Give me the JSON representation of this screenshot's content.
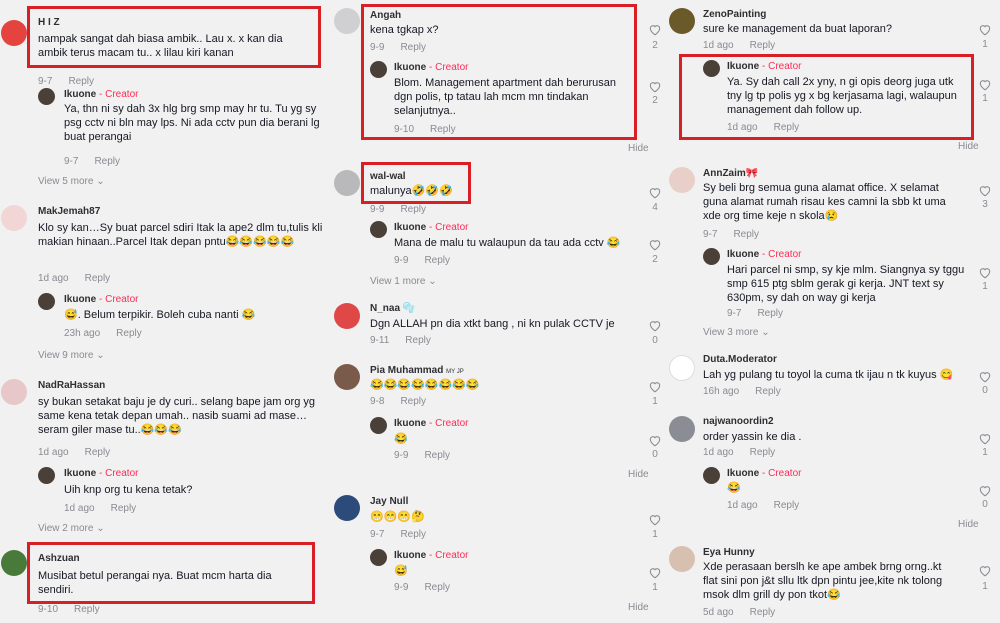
{
  "columns": [
    {
      "comments": [
        {
          "username": "H I Z",
          "text": "nampak sangat dah biasa ambik.. Lau x. x kan dia ambik terus macam tu.. x lilau kiri kanan",
          "date": "9-7",
          "reply": "Reply",
          "likes": "",
          "avatar": "#e4433e",
          "replies": [
            {
              "username": "Ikuone",
              "creator": "- Creator",
              "text": "Ya, thn ni sy dah 3x hlg brg smp may hr tu. Tu yg sy psg cctv ni bln may lps. Ni ada cctv pun dia berani lg buat perangai",
              "date": "9-7",
              "reply": "Reply",
              "likes": ""
            }
          ],
          "more": "View 5 more"
        },
        {
          "username": "MakJemah87",
          "text": "Klo sy kan…Sy buat parcel sdiri Itak la ape2 dlm tu,tulis kli makian hinaan..Parcel Itak depan pntu😂😂😂😂😂",
          "date": "1d ago",
          "reply": "Reply",
          "likes": "",
          "avatar": "#f2d6d6",
          "replies": [
            {
              "username": "Ikuone",
              "creator": "- Creator",
              "text": "😅. Belum terpikir. Boleh cuba nanti 😂",
              "date": "23h ago",
              "reply": "Reply",
              "likes": ""
            }
          ],
          "more": "View 9 more"
        },
        {
          "username": "NadRaHassan",
          "text": "sy bukan setakat baju je dy curi.. selang bape jam org yg same kena tetak depan umah.. nasib suami ad mase… seram giler mase tu..😂😂😂",
          "date": "1d ago",
          "reply": "Reply",
          "likes": "",
          "avatar": "#e7c7c9",
          "replies": [
            {
              "username": "Ikuone",
              "creator": "- Creator",
              "text": "Uih knp org tu kena tetak?",
              "date": "1d ago",
              "reply": "Reply",
              "likes": ""
            }
          ],
          "more": "View 2 more"
        },
        {
          "username": "Ashzuan",
          "text": "Musibat betul perangai nya. Buat mcm harta dia sendiri.",
          "date": "9-10",
          "reply": "Reply",
          "likes": "",
          "avatar": "#4a7a3a",
          "replies": []
        }
      ]
    },
    {
      "comments": [
        {
          "username": "Angah",
          "text": "kena tgkap x?",
          "date": "9-9",
          "reply": "Reply",
          "likes": "2",
          "avatar": "#d0d0d2",
          "replies": [
            {
              "username": "Ikuone",
              "creator": "- Creator",
              "text": "Blom. Management apartment dah berurusan dgn polis, tp tatau lah mcm mn tindakan selanjutnya..",
              "date": "9-10",
              "reply": "Reply",
              "likes": "2"
            }
          ],
          "hide": "Hide"
        },
        {
          "username": "wal-wal",
          "text": "malunya🤣🤣🤣",
          "date": "9-9",
          "reply": "Reply",
          "likes": "4",
          "avatar": "#b9b9bb",
          "replies": [
            {
              "username": "Ikuone",
              "creator": "- Creator",
              "text": "Mana de malu tu walaupun da tau ada cctv 😂",
              "date": "9-9",
              "reply": "Reply",
              "likes": "2"
            }
          ],
          "more": "View 1 more"
        },
        {
          "username": "N_naa 🫧",
          "text": "Dgn ALLAH pn dia xtkt bang , ni kn pulak CCTV je",
          "date": "9-11",
          "reply": "Reply",
          "likes": "0",
          "avatar": "#e04848",
          "replies": []
        },
        {
          "username": "Pia Muhammad",
          "badge": "MY JP",
          "text": "😂😂😂😂😂😂😂😂",
          "date": "9-8",
          "reply": "Reply",
          "likes": "1",
          "avatar": "#7a5a4a",
          "replies": [
            {
              "username": "Ikuone",
              "creator": "- Creator",
              "text": "😂",
              "date": "9-9",
              "reply": "Reply",
              "likes": "0"
            }
          ],
          "hide": "Hide"
        },
        {
          "username": "Jay Null",
          "text": "😁😁😁🤔",
          "date": "9-7",
          "reply": "Reply",
          "likes": "1",
          "avatar": "#2c4a7a",
          "replies": [
            {
              "username": "Ikuone",
              "creator": "- Creator",
              "text": "😅",
              "date": "9-9",
              "reply": "Reply",
              "likes": "1"
            }
          ],
          "hide": "Hide"
        }
      ]
    },
    {
      "comments": [
        {
          "username": "ZenoPainting",
          "text": "sure ke management da buat laporan?",
          "date": "1d ago",
          "reply": "Reply",
          "likes": "1",
          "avatar": "#6a5a2a",
          "replies": [
            {
              "username": "Ikuone",
              "creator": "- Creator",
              "text": "Ya. Sy dah call 2x yny, n gi opis deorg juga utk tny lg tp polis yg x bg kerjasama lagi, walaupun management dah follow up.",
              "date": "1d ago",
              "reply": "Reply",
              "likes": "1"
            }
          ],
          "hide": "Hide"
        },
        {
          "username": "AnnZaim🎀",
          "text": "Sy beli brg semua guna alamat office. X selamat guna alamat rumah risau kes camni la sbb kt uma xde org time keje n skola😢",
          "date": "9-7",
          "reply": "Reply",
          "likes": "3",
          "avatar": "#e8d0c8",
          "replies": [
            {
              "username": "Ikuone",
              "creator": "- Creator",
              "text": "Hari parcel ni smp, sy kje mlm. Siangnya sy tggu smp 615 ptg sblm gerak gi kerja. JNT text sy 630pm, sy dah on way gi kerja",
              "date": "9-7",
              "reply": "Reply",
              "likes": "1"
            }
          ],
          "more": "View 3 more"
        },
        {
          "username": "Duta.Moderator",
          "text": "Lah yg pulang tu toyol la cuma tk ijau n tk kuyus 😋",
          "date": "16h ago",
          "reply": "Reply",
          "likes": "0",
          "avatar": "#ffffff",
          "replies": []
        },
        {
          "username": "najwanoordin2",
          "text": "order yassin ke dia .",
          "date": "1d ago",
          "reply": "Reply",
          "likes": "1",
          "avatar": "#8a8e94",
          "replies": [
            {
              "username": "Ikuone",
              "creator": "- Creator",
              "text": "😂",
              "date": "1d ago",
              "reply": "Reply",
              "likes": "0"
            }
          ],
          "hide": "Hide"
        },
        {
          "username": "Eya Hunny",
          "text": "Xde perasaan berslh ke ape ambek brng orng..kt flat sini pon j&t sllu ltk dpn pintu jee,kite nk tolong msok dlm grill dy pon tkot😂",
          "date": "5d ago",
          "reply": "Reply",
          "likes": "1",
          "avatar": "#d8c0b0",
          "replies": []
        }
      ]
    }
  ],
  "colors": {
    "highlight": "#d91f26",
    "creator": "#fe2c55",
    "meta": "#8a8b91",
    "background": "#f1f1f2"
  },
  "icons": {
    "like": "heart-outline-icon",
    "expand": "chevron-down-icon",
    "creator_avatar": "user-avatar-icon"
  }
}
